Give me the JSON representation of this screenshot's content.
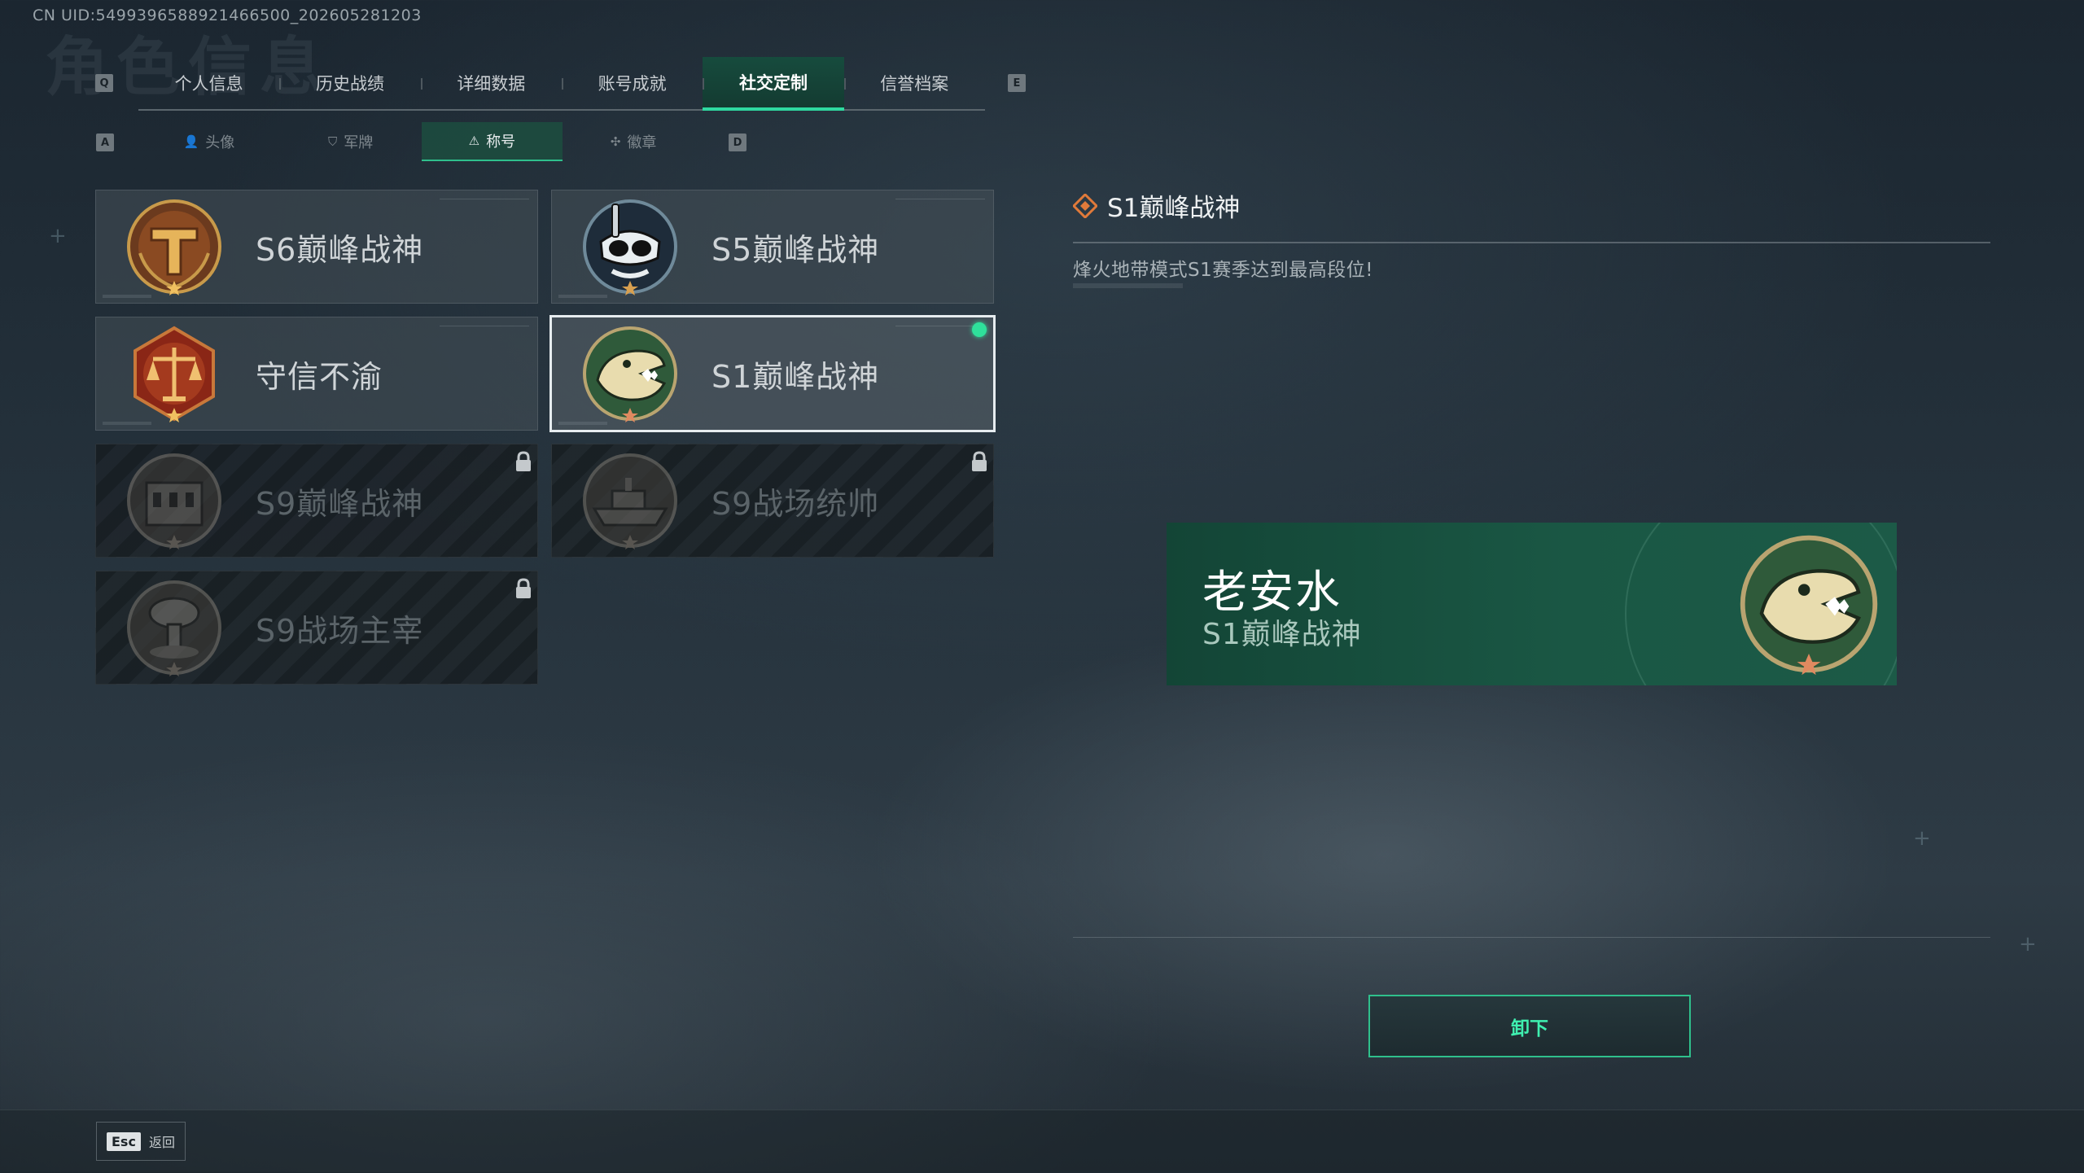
{
  "uid_text": "CN UID:5499396588921466500_202605281203",
  "ghost_title": "角色信息",
  "keys": {
    "prev_tab": "Q",
    "next_tab": "E",
    "prev_sub": "A",
    "next_sub": "D"
  },
  "tabs": [
    {
      "label": "个人信息",
      "active": false
    },
    {
      "label": "历史战绩",
      "active": false
    },
    {
      "label": "详细数据",
      "active": false
    },
    {
      "label": "账号成就",
      "active": false
    },
    {
      "label": "社交定制",
      "active": true
    },
    {
      "label": "信誉档案",
      "active": false
    }
  ],
  "subtabs": [
    {
      "label": "头像",
      "icon": "person-icon",
      "active": false
    },
    {
      "label": "军牌",
      "icon": "dogtag-icon",
      "active": false
    },
    {
      "label": "称号",
      "icon": "title-icon",
      "active": true
    },
    {
      "label": "徽章",
      "icon": "badge-icon",
      "active": false
    }
  ],
  "titles": [
    {
      "name": "S6巅峰战神",
      "emblem": "gold-t-emblem-icon",
      "locked": false,
      "selected": false
    },
    {
      "name": "S5巅峰战神",
      "emblem": "diving-mask-emblem-icon",
      "locked": false,
      "selected": false
    },
    {
      "name": "守信不渝",
      "emblem": "scales-emblem-icon",
      "locked": false,
      "selected": false
    },
    {
      "name": "S1巅峰战神",
      "emblem": "crocodile-emblem-icon",
      "locked": false,
      "selected": true,
      "equipped": true
    },
    {
      "name": "S9巅峰战神",
      "emblem": "ruins-emblem-icon",
      "locked": true,
      "selected": false
    },
    {
      "name": "S9战场统帅",
      "emblem": "warship-emblem-icon",
      "locked": true,
      "selected": false
    },
    {
      "name": "S9战场主宰",
      "emblem": "mushroom-cloud-emblem-icon",
      "locked": true,
      "selected": false
    }
  ],
  "detail": {
    "title": "S1巅峰战神",
    "description": "烽火地带模式S1赛季达到最高段位!"
  },
  "preview": {
    "player_name": "老安水",
    "title": "S1巅峰战神"
  },
  "unequip_label": "卸下",
  "footer": {
    "esc_key": "Esc",
    "back_label": "返回"
  },
  "colors": {
    "accent": "#2fe09b",
    "tab_active": "#1c4e40",
    "preview_bg": "#1a5744"
  }
}
